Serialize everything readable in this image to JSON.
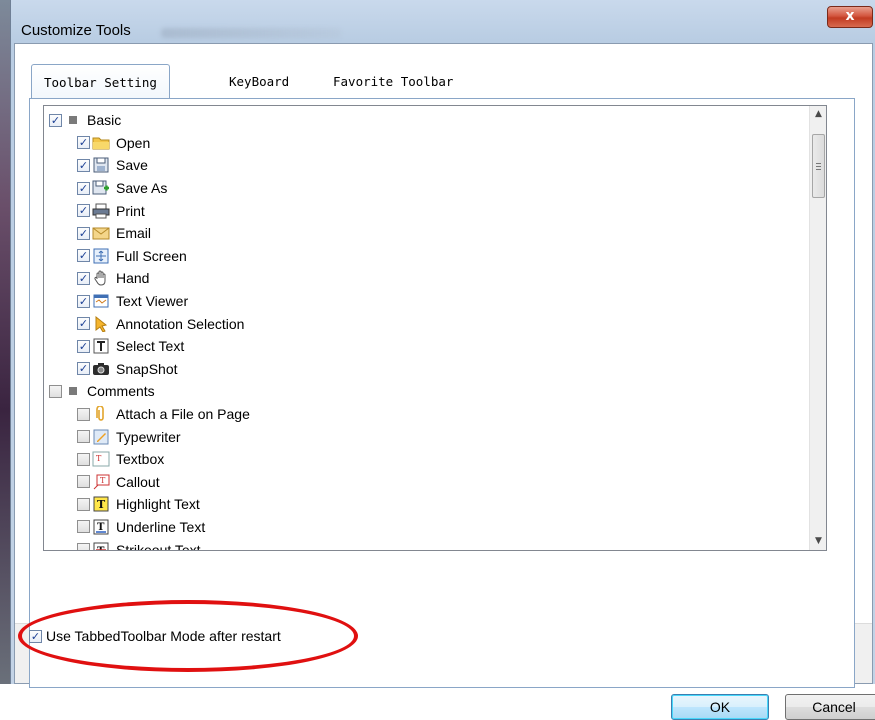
{
  "window": {
    "title": "Customize Tools",
    "close_glyph": "x"
  },
  "tabs": [
    {
      "label": "Toolbar Setting",
      "active": true
    },
    {
      "label": "KeyBoard",
      "active": false
    },
    {
      "label": "Favorite Toolbar",
      "active": false
    }
  ],
  "groups": [
    {
      "label": "Basic",
      "checked": true,
      "items": [
        {
          "label": "Open",
          "icon": "folder-icon",
          "checked": true
        },
        {
          "label": "Save",
          "icon": "floppy-icon",
          "checked": true
        },
        {
          "label": "Save As",
          "icon": "save-as-icon",
          "checked": true
        },
        {
          "label": "Print",
          "icon": "printer-icon",
          "checked": true
        },
        {
          "label": "Email",
          "icon": "email-icon",
          "checked": true
        },
        {
          "label": "Full Screen",
          "icon": "fullscreen-icon",
          "checked": true
        },
        {
          "label": "Hand",
          "icon": "hand-icon",
          "checked": true
        },
        {
          "label": "Text Viewer",
          "icon": "text-viewer-icon",
          "checked": true
        },
        {
          "label": "Annotation Selection",
          "icon": "arrow-cursor-icon",
          "checked": true
        },
        {
          "label": "Select Text",
          "icon": "select-text-icon",
          "checked": true
        },
        {
          "label": "SnapShot",
          "icon": "camera-icon",
          "checked": true
        }
      ]
    },
    {
      "label": "Comments",
      "checked": false,
      "items": [
        {
          "label": "Attach a File on Page",
          "icon": "paperclip-icon",
          "checked": false
        },
        {
          "label": "Typewriter",
          "icon": "typewriter-icon",
          "checked": false
        },
        {
          "label": "Textbox",
          "icon": "textbox-icon",
          "checked": false
        },
        {
          "label": "Callout",
          "icon": "callout-icon",
          "checked": false
        },
        {
          "label": "Highlight Text",
          "icon": "highlight-icon",
          "checked": false
        },
        {
          "label": "Underline Text",
          "icon": "underline-icon",
          "checked": false
        },
        {
          "label": "Strikeout Text",
          "icon": "strikeout-icon",
          "checked": false
        }
      ]
    }
  ],
  "option": {
    "label": "Use TabbedToolbar Mode after restart",
    "checked": true
  },
  "buttons": {
    "ok": "OK",
    "cancel": "Cancel"
  },
  "colors": {
    "highlight_oval": "#e01010",
    "check_mark": "#1c3f94"
  }
}
